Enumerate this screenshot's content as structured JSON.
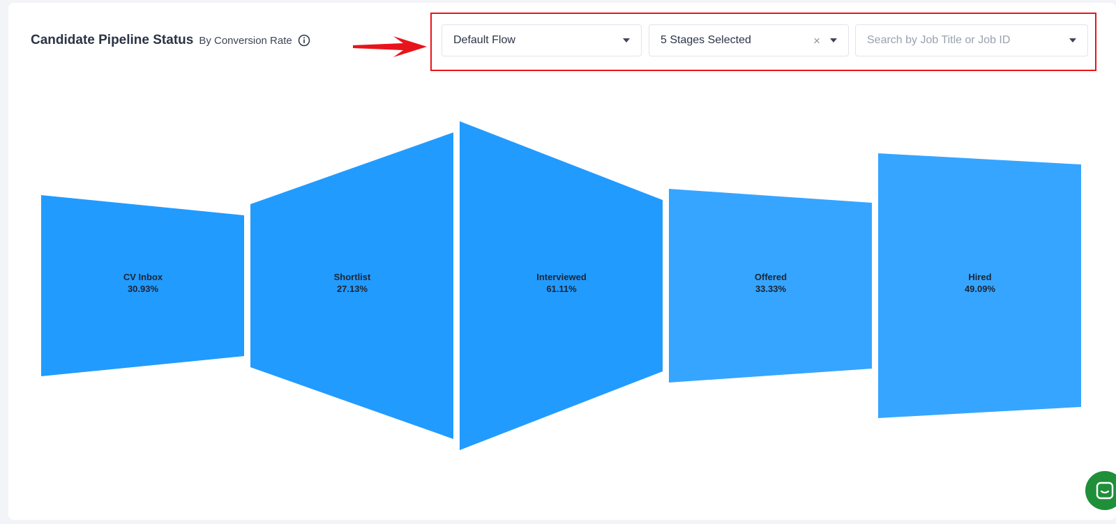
{
  "header": {
    "title": "Candidate Pipeline Status",
    "subtitle": "By Conversion Rate"
  },
  "filters": {
    "flow": {
      "value": "Default Flow"
    },
    "stages": {
      "value": "5 Stages Selected"
    },
    "job_search": {
      "placeholder": "Search by Job Title or Job ID"
    }
  },
  "colors": {
    "funnel_primary": "#229bff",
    "funnel_secondary": "#36a5ff",
    "highlight": "#e8141b",
    "chat": "#1f8f3a"
  },
  "chart_data": {
    "type": "funnel",
    "metric": "conversion rate",
    "stages": [
      {
        "name": "CV Inbox",
        "label": "30.93%",
        "value": 30.93
      },
      {
        "name": "Shortlist",
        "label": "27.13%",
        "value": 27.13
      },
      {
        "name": "Interviewed",
        "label": "61.11%",
        "value": 61.11
      },
      {
        "name": "Offered",
        "label": "33.33%",
        "value": 33.33
      },
      {
        "name": "Hired",
        "label": "49.09%",
        "value": 49.09
      }
    ]
  }
}
